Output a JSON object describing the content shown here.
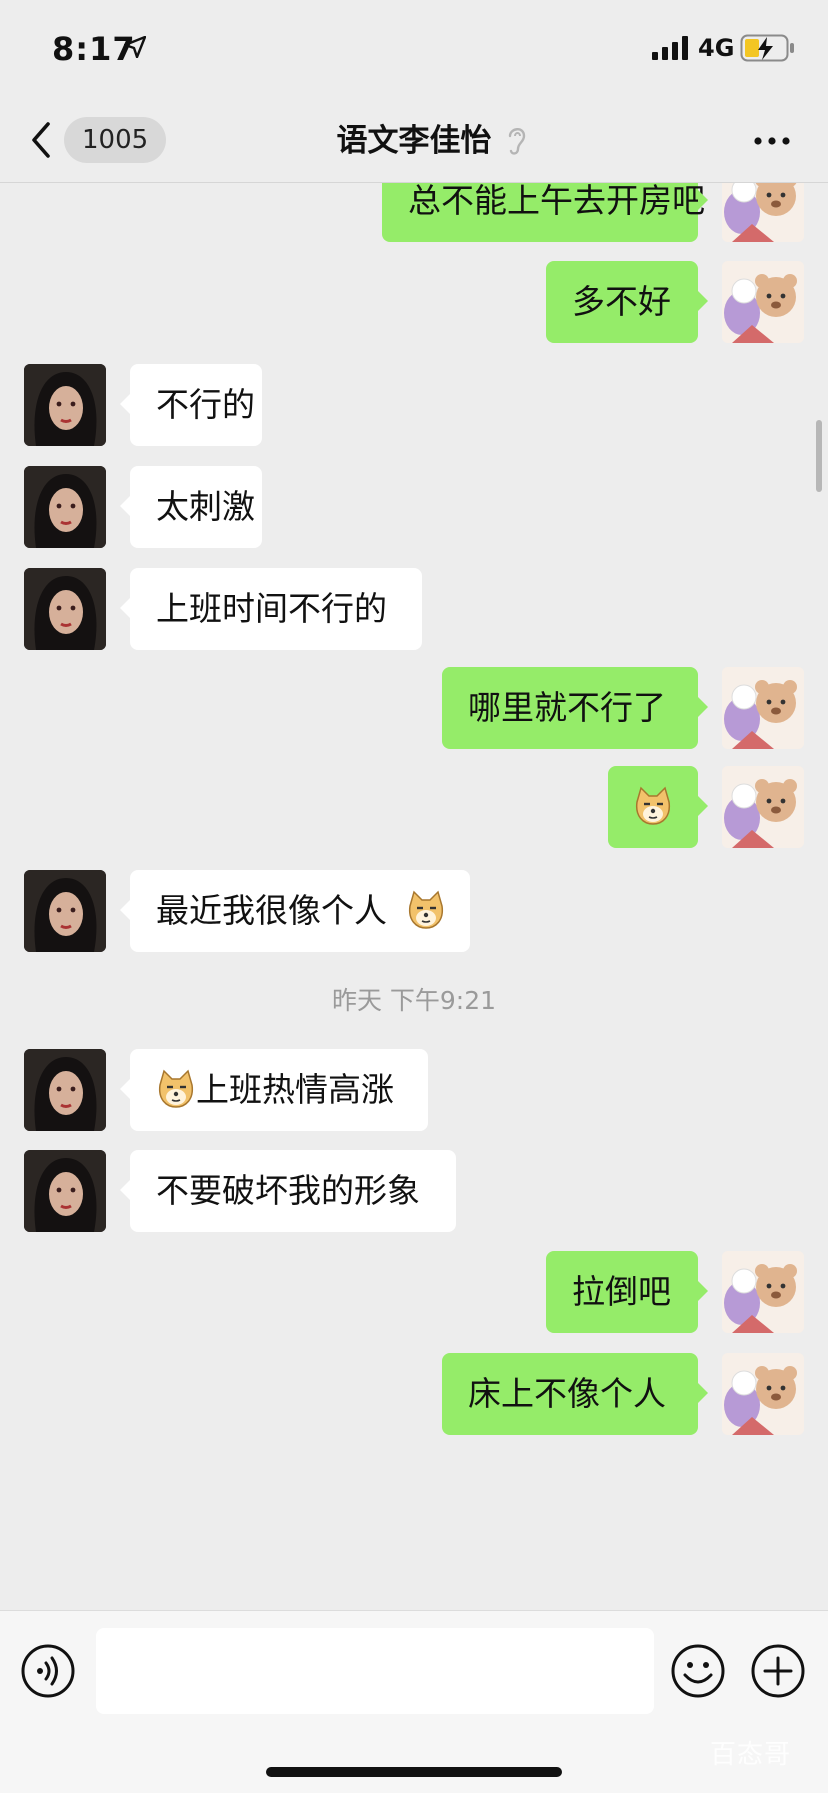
{
  "status_bar": {
    "time": "8:17",
    "network": "4G",
    "location_icon": "location-arrow-icon",
    "battery_icon": "battery-charging-icon"
  },
  "nav": {
    "back_icon": "chevron-left-icon",
    "unread_count": "1005",
    "title": "语文李佳怡",
    "earpiece_icon": "ear-icon",
    "more_icon": "more-dots-icon"
  },
  "messages": [
    {
      "side": "out",
      "text": "总不能上午去开房吧"
    },
    {
      "side": "out",
      "text": "多不好"
    },
    {
      "side": "in",
      "text": "不行的"
    },
    {
      "side": "in",
      "text": "太刺激"
    },
    {
      "side": "in",
      "text": "上班时间不行的"
    },
    {
      "side": "out",
      "text": "哪里就不行了"
    },
    {
      "side": "out",
      "text": "",
      "emoji": "doge-emoji"
    },
    {
      "side": "in",
      "text": "最近我很像个人",
      "emoji_after": "doge-emoji"
    },
    {
      "side": "in",
      "text": "上班热情高涨",
      "emoji_before": "doge-emoji"
    },
    {
      "side": "in",
      "text": "不要破坏我的形象"
    },
    {
      "side": "out",
      "text": "拉倒吧"
    },
    {
      "side": "out",
      "text": "床上不像个人"
    }
  ],
  "timestamp": "昨天 下午9:21",
  "input_bar": {
    "voice_icon": "voice-icon",
    "emoji_icon": "smiley-icon",
    "plus_icon": "plus-icon",
    "value": ""
  },
  "watermark": "百态哥",
  "colors": {
    "background": "#ededed",
    "outgoing_bubble": "#95ec69",
    "incoming_bubble": "#ffffff"
  }
}
